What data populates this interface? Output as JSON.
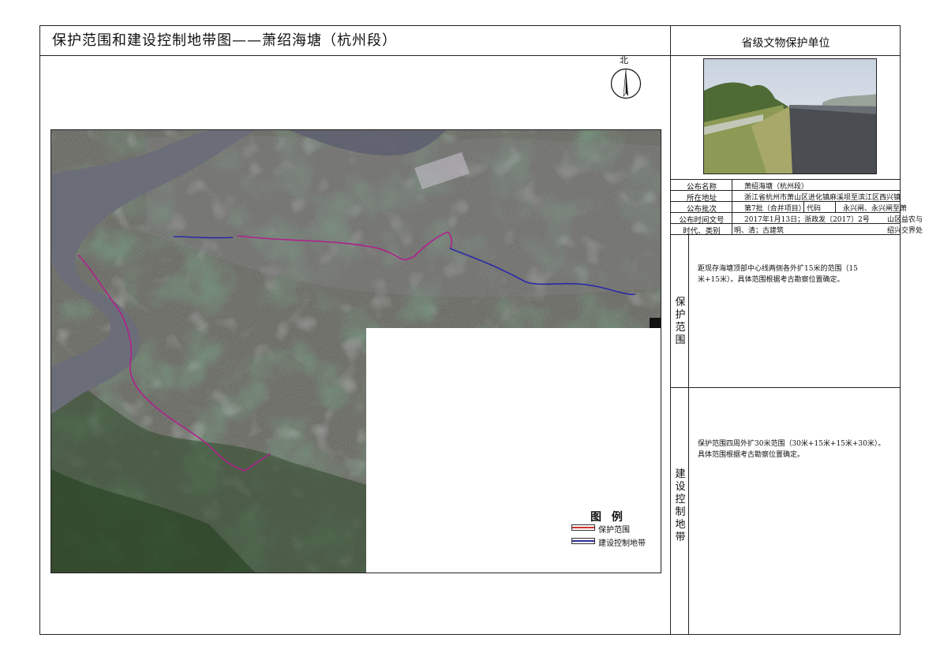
{
  "map_title": "保护范围和建设控制地带图——萧绍海塘（杭州段）",
  "panel_title": "省级文物保护单位",
  "north_label": "北",
  "info_table": {
    "rows": [
      {
        "label": "公布名称",
        "value": "萧绍海塘（杭州段）"
      },
      {
        "label": "所在地址",
        "value": "浙江省杭州市萧山区进化镇麻溪坝至滨江区西兴镇"
      },
      {
        "label": "公布批次",
        "value": "第7批（合并项目）",
        "code_label": "代码",
        "extra": "永兴闸、永兴闸至萧"
      },
      {
        "label": "公布时间文号",
        "value": "2017年1月13日；浙政发〔2017〕2号",
        "extra": "山区益农与"
      },
      {
        "label": "时代、类别",
        "value": "明、清；古建筑",
        "extra": "绍兴交界处"
      }
    ]
  },
  "protection_zone": {
    "label": "保护范围",
    "label_chars": [
      "保",
      "护",
      "范",
      "围"
    ],
    "text_line1": "距现存海塘顶部中心线两侧各外扩15米的范围（15",
    "text_line2": "米+15米）。具体范围根据考古勘察位置确定。"
  },
  "control_zone": {
    "label": "建设控制地带",
    "label_chars": [
      "建",
      "设",
      "控",
      "制",
      "地",
      "带"
    ],
    "text_line1": "保护范围四周外扩30米范围（30米+15米+15米+30米）。",
    "text_line2": "具体范围根据考古勘察位置确定。"
  },
  "legend": {
    "title": "图 例",
    "items": [
      {
        "label": "保护范围",
        "color": "#d0312d"
      },
      {
        "label": "建设控制地带",
        "color": "#2b2e9e"
      }
    ]
  },
  "colors": {
    "protection_line": "#b0208c",
    "control_line": "#2a2aa8",
    "river": "#6b6e78"
  }
}
